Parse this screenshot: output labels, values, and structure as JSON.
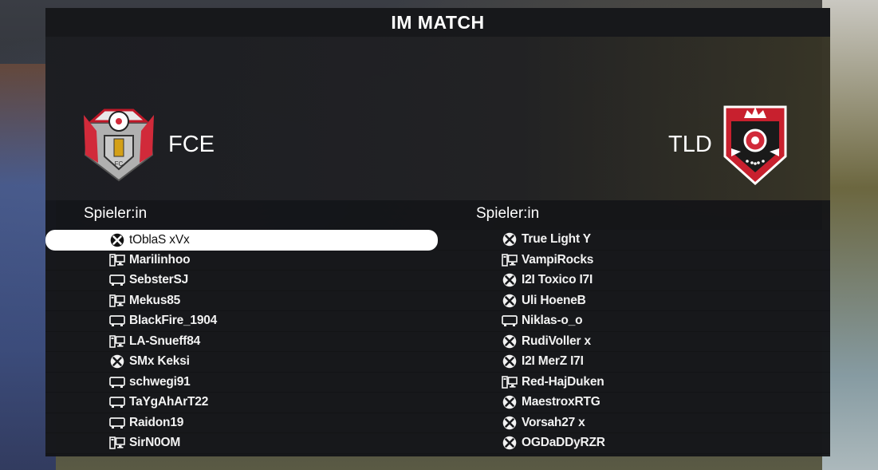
{
  "screen": {
    "title": "IM MATCH"
  },
  "home": {
    "name": "FCE",
    "column_header": "Spieler:in",
    "crest": "fce-crest-icon",
    "players": [
      {
        "name": "tOblaS xVx",
        "platform": "xbox-icon",
        "selected": true
      },
      {
        "name": "Marilinhoo",
        "platform": "pc-icon"
      },
      {
        "name": "SebsterSJ",
        "platform": "console-icon"
      },
      {
        "name": "Mekus85",
        "platform": "pc-icon"
      },
      {
        "name": "BlackFire_1904",
        "platform": "console-icon"
      },
      {
        "name": "LA-Snueff84",
        "platform": "pc-icon"
      },
      {
        "name": "SMx Keksi",
        "platform": "xbox-icon"
      },
      {
        "name": "schwegi91",
        "platform": "console-icon"
      },
      {
        "name": "TaYgAhArT22",
        "platform": "console-icon"
      },
      {
        "name": "Raidon19",
        "platform": "console-icon"
      },
      {
        "name": "SirN0OM",
        "platform": "pc-icon"
      }
    ]
  },
  "away": {
    "name": "TLD",
    "column_header": "Spieler:in",
    "crest": "tld-crest-icon",
    "players": [
      {
        "name": "True Light Y",
        "platform": "xbox-icon"
      },
      {
        "name": "VampiRocks",
        "platform": "pc-icon"
      },
      {
        "name": "I2I Toxico I7I",
        "platform": "xbox-icon"
      },
      {
        "name": "Uli HoeneB",
        "platform": "xbox-icon"
      },
      {
        "name": "Niklas-o_o",
        "platform": "console-icon"
      },
      {
        "name": "RudiVoller x",
        "platform": "xbox-icon"
      },
      {
        "name": "I2I MerZ I7I",
        "platform": "xbox-icon"
      },
      {
        "name": "Red-HajDuken",
        "platform": "pc-icon"
      },
      {
        "name": "MaestroxRTG",
        "platform": "xbox-icon"
      },
      {
        "name": "Vorsah27 x",
        "platform": "xbox-icon"
      },
      {
        "name": "OGDaDDyRZR",
        "platform": "xbox-icon"
      }
    ]
  },
  "colors": {
    "panel": "#121316",
    "selected_row": "#ffffff",
    "text": "#f2f2f2",
    "away_crest_red": "#c8202e"
  }
}
